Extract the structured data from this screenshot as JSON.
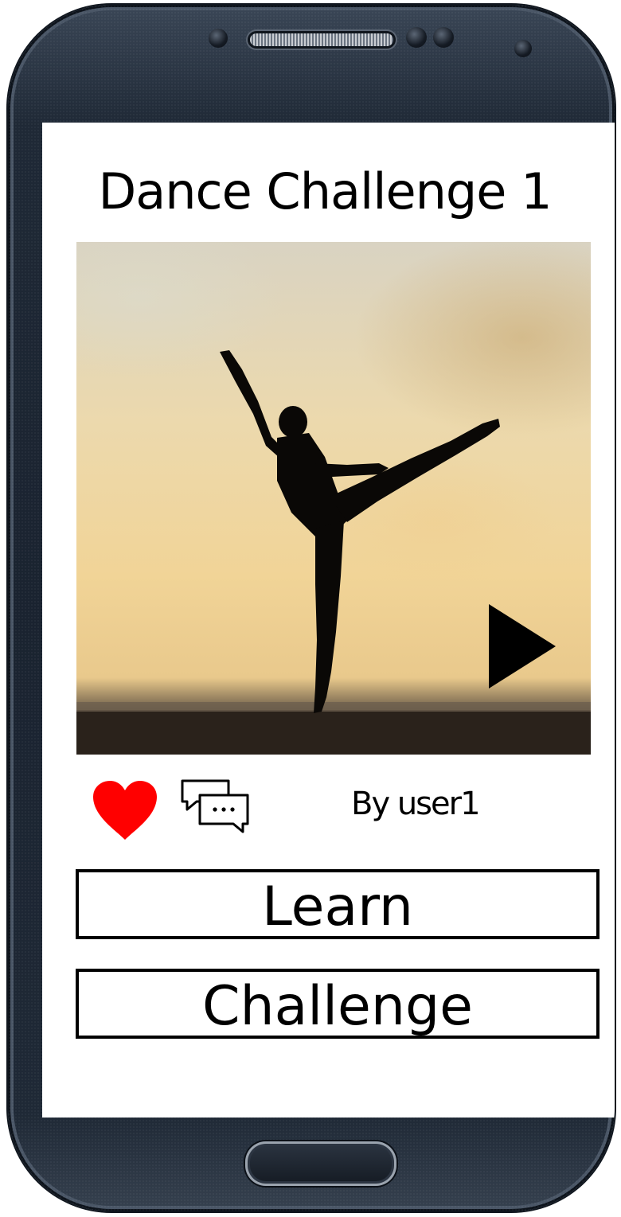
{
  "screen": {
    "title": "Dance Challenge 1"
  },
  "video": {
    "thumbnail_description_icon": "dancer-silhouette",
    "play_icon": "play-icon"
  },
  "actions": {
    "like_icon": "heart-icon",
    "like_color": "#ff0000",
    "comment_icon": "comment-bubbles-icon",
    "author": "By user1"
  },
  "buttons": {
    "learn_label": "Learn",
    "challenge_label": "Challenge"
  }
}
